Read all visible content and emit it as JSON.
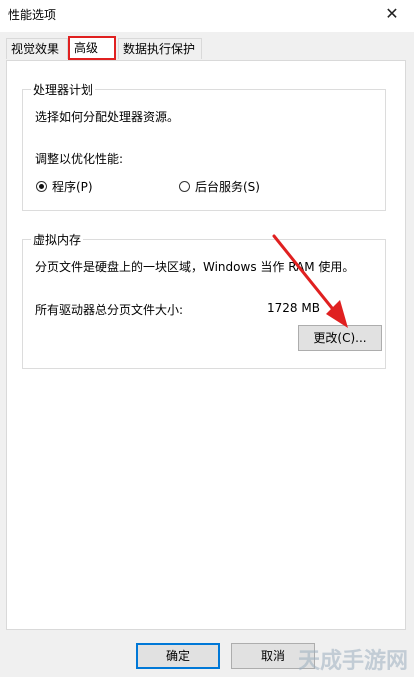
{
  "window": {
    "title": "性能选项",
    "close_glyph": "✕"
  },
  "tabs": [
    {
      "label": "视觉效果"
    },
    {
      "label": "高级"
    },
    {
      "label": "数据执行保护"
    }
  ],
  "processor": {
    "title": "处理器计划",
    "description": "选择如何分配处理器资源。",
    "adjust_label": "调整以优化性能:",
    "option_programs": "程序(P)",
    "option_services": "后台服务(S)",
    "selected": "programs"
  },
  "virtual_memory": {
    "title": "虚拟内存",
    "description": "分页文件是硬盘上的一块区域，Windows 当作 RAM 使用。",
    "total_label": "所有驱动器总分页文件大小:",
    "total_value": "1728 MB",
    "change_button": "更改(C)..."
  },
  "footer": {
    "ok_button": "确定",
    "cancel_button": "取消"
  },
  "watermark": "天成手游网",
  "colors": {
    "highlight": "#e02020",
    "default_button_border": "#0078d7"
  }
}
